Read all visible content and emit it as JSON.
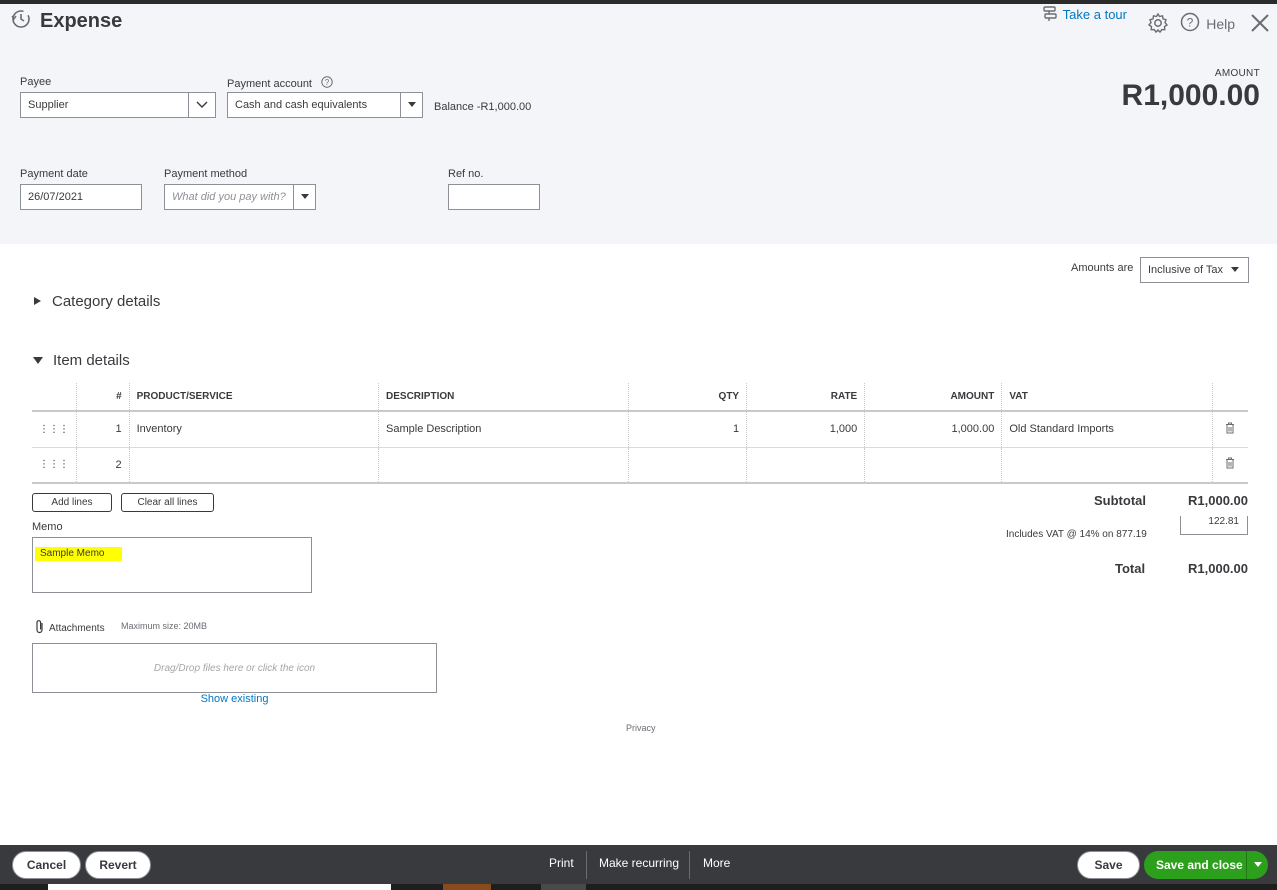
{
  "header": {
    "title": "Expense",
    "take_tour": "Take a tour",
    "help": "Help",
    "amount_label": "AMOUNT",
    "amount_value": "R1,000.00"
  },
  "form": {
    "payee_label": "Payee",
    "payee_value": "Supplier",
    "payment_account_label": "Payment account",
    "payment_account_value": "Cash and cash equivalents",
    "balance": "Balance -R1,000.00",
    "payment_date_label": "Payment date",
    "payment_date_value": "26/07/2021",
    "payment_method_label": "Payment method",
    "payment_method_placeholder": "What did you pay with?",
    "ref_no_label": "Ref no.",
    "ref_no_value": ""
  },
  "tax": {
    "amounts_are_label": "Amounts are",
    "amounts_are_value": "Inclusive of Tax"
  },
  "sections": {
    "category_details": "Category details",
    "item_details": "Item details"
  },
  "items_table": {
    "headers": [
      "#",
      "PRODUCT/SERVICE",
      "DESCRIPTION",
      "QTY",
      "RATE",
      "AMOUNT",
      "VAT"
    ],
    "rows": [
      {
        "num": "1",
        "product": "Inventory",
        "description": "Sample Description",
        "qty": "1",
        "rate": "1,000",
        "amount": "1,000.00",
        "vat": "Old Standard Imports"
      },
      {
        "num": "2",
        "product": "",
        "description": "",
        "qty": "",
        "rate": "",
        "amount": "",
        "vat": ""
      }
    ]
  },
  "buttons": {
    "add_lines": "Add lines",
    "clear_all_lines": "Clear all lines"
  },
  "totals": {
    "subtotal_label": "Subtotal",
    "subtotal_value": "R1,000.00",
    "vat_label": "Includes VAT @ 14% on 877.19",
    "vat_value": "122.81",
    "total_label": "Total",
    "total_value": "R1,000.00"
  },
  "memo": {
    "label": "Memo",
    "value": "Sample Memo"
  },
  "attachments": {
    "label": "Attachments",
    "max_size": "Maximum size: 20MB",
    "drop_text": "Drag/Drop files here or click the icon",
    "show_existing": "Show existing"
  },
  "privacy": "Privacy",
  "footer": {
    "cancel": "Cancel",
    "revert": "Revert",
    "print": "Print",
    "make_recurring": "Make recurring",
    "more": "More",
    "save": "Save",
    "save_and_close": "Save and close"
  },
  "colors": {
    "link": "#0077c5",
    "primary_green": "#2ca01c",
    "footer_bg": "#393a3d",
    "header_bg": "#f4f5f8",
    "memo_highlight": "#ffff00"
  }
}
